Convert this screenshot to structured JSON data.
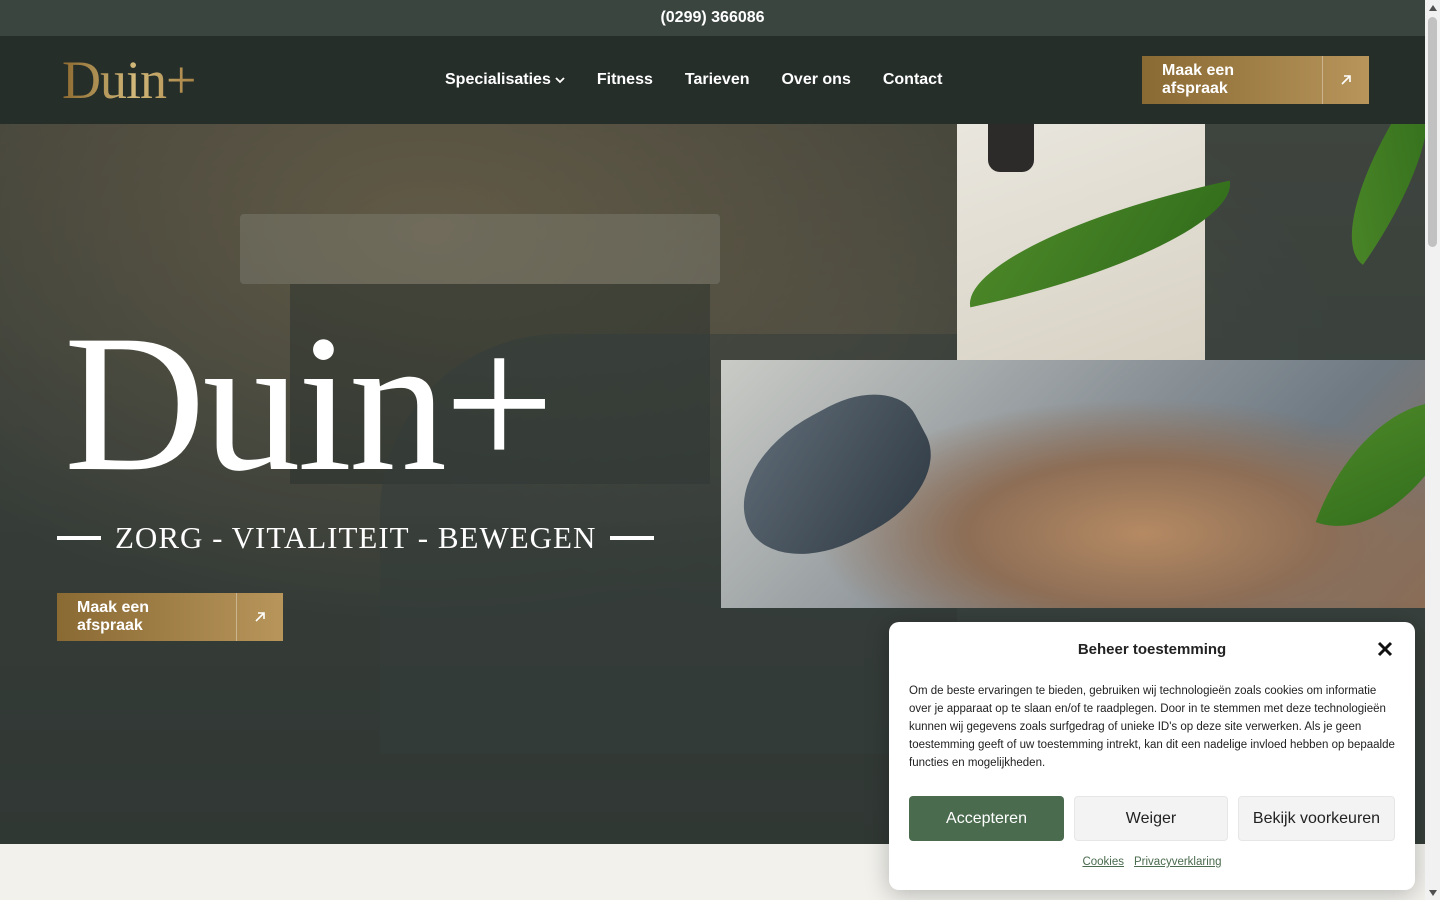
{
  "topbar": {
    "phone": "(0299) 366086"
  },
  "header": {
    "logo": "Duin+",
    "nav": [
      {
        "label": "Specialisaties",
        "has_dropdown": true,
        "icon": "chevron-down-icon"
      },
      {
        "label": "Fitness"
      },
      {
        "label": "Tarieven"
      },
      {
        "label": "Over ons"
      },
      {
        "label": "Contact"
      }
    ],
    "cta_label": "Maak een afspraak",
    "cta_icon": "arrow-up-right-icon"
  },
  "hero": {
    "title": "Duin+",
    "tagline": "ZORG - VITALITEIT - BEWEGEN",
    "cta_label": "Maak een afspraak",
    "cta_icon": "arrow-up-right-icon"
  },
  "cookie_dialog": {
    "title": "Beheer toestemming",
    "close_icon": "close-icon",
    "text": "Om de beste ervaringen te bieden, gebruiken wij technologieën zoals cookies om informatie over je apparaat op te slaan en/of te raadplegen. Door in te stemmen met deze technologieën kunnen wij gegevens zoals surfgedrag of unieke ID's op deze site verwerken. Als je geen toestemming geeft of uw toestemming intrekt, kan dit een nadelige invloed hebben op bepaalde functies en mogelijkheden.",
    "accept_label": "Accepteren",
    "deny_label": "Weiger",
    "prefs_label": "Bekijk voorkeuren",
    "links": [
      "Cookies",
      "Privacyverklaring"
    ]
  },
  "colors": {
    "topbar": "#3b4540",
    "header": "#262e2a",
    "gold": "#b08d4f",
    "accept": "#4a6b4e"
  }
}
